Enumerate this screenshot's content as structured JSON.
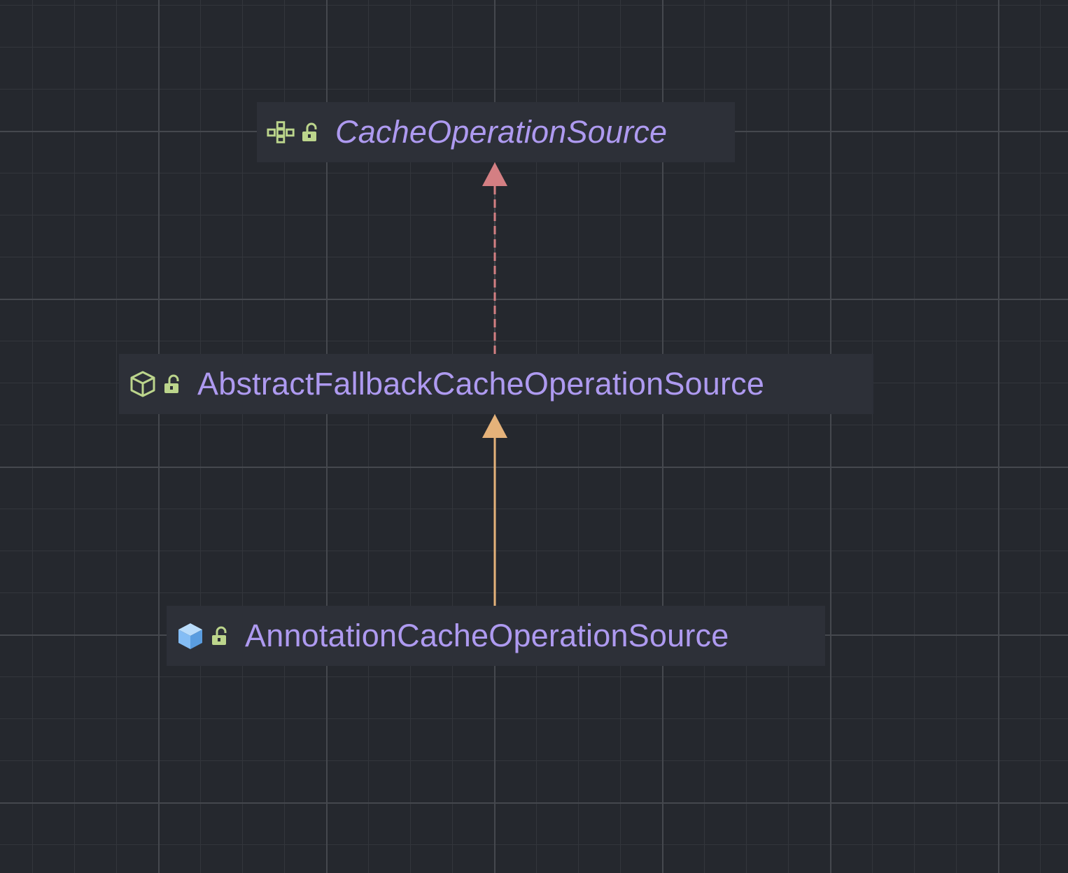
{
  "colors": {
    "background": "#25282e",
    "node_background": "#2d3038",
    "label": "#ae9af0",
    "implements_edge": "#d47f83",
    "extends_edge": "#e5b27a",
    "icon_green": "#bcd58c",
    "icon_blue": "#84bdf5"
  },
  "diagram": {
    "nodes": [
      {
        "id": "interface",
        "label": "CacheOperationSource",
        "kind": "interface",
        "kind_icon": "interface-icon",
        "visibility_icon": "public-lock-icon",
        "italic": true
      },
      {
        "id": "abstract",
        "label": "AbstractFallbackCacheOperationSource",
        "kind": "abstract-class",
        "kind_icon": "abstract-class-icon",
        "visibility_icon": "public-lock-icon",
        "italic": false
      },
      {
        "id": "class",
        "label": "AnnotationCacheOperationSource",
        "kind": "class",
        "kind_icon": "class-icon",
        "visibility_icon": "public-lock-icon",
        "italic": false
      }
    ],
    "edges": [
      {
        "from": "abstract",
        "to": "interface",
        "type": "implements",
        "style": "dashed"
      },
      {
        "from": "class",
        "to": "abstract",
        "type": "extends",
        "style": "solid"
      }
    ]
  }
}
